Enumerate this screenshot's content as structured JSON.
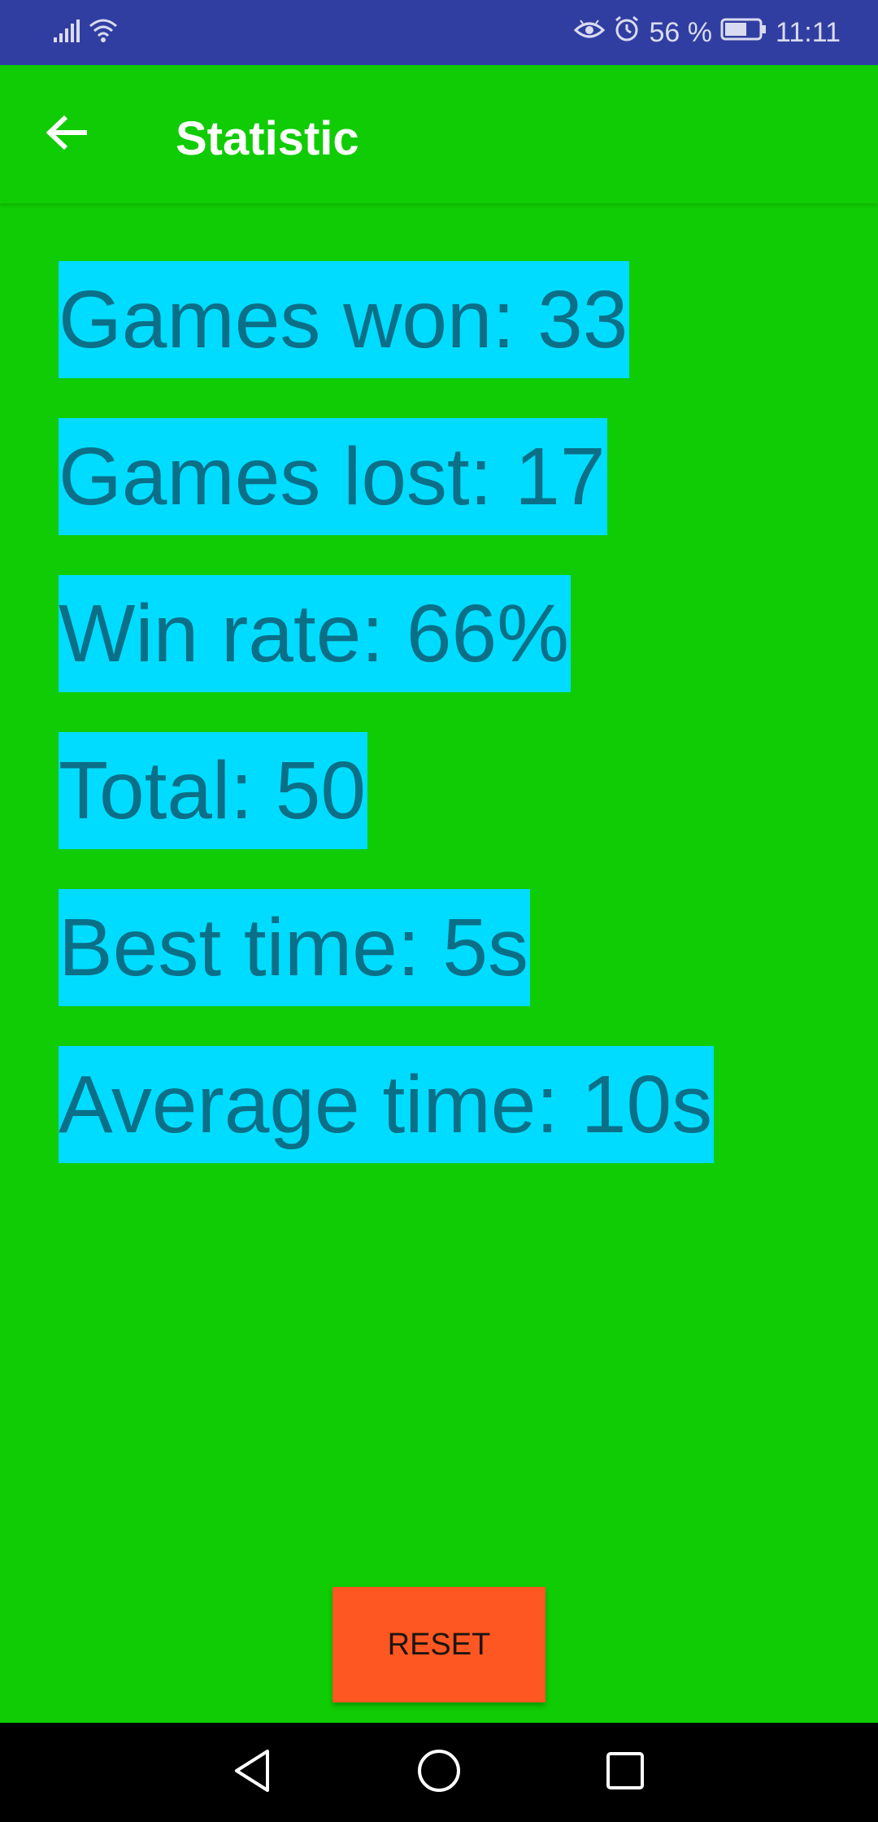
{
  "status_bar": {
    "battery": "56 %",
    "time": "11:11",
    "icons": [
      "signal-icon",
      "wifi-icon",
      "eye-comfort-icon",
      "alarm-icon",
      "battery-icon"
    ]
  },
  "app_bar": {
    "title": "Statistic",
    "back_icon": "arrow-back-icon"
  },
  "stats": {
    "games_won": "Games won: 33",
    "games_lost": "Games lost: 17",
    "win_rate": "Win rate: 66%",
    "total": "Total: 50",
    "best_time": "Best time: 5s",
    "average_time": "Average time: 10s"
  },
  "actions": {
    "reset_label": "RESET"
  },
  "nav_bar": {
    "icons": [
      "back-triangle-icon",
      "home-circle-icon",
      "recents-square-icon"
    ]
  },
  "colors": {
    "status_bar": "#313ea1",
    "background": "#10cc04",
    "stat_highlight": "#00dcff",
    "stat_text": "#0b6f87",
    "reset_button": "#ff5722"
  }
}
